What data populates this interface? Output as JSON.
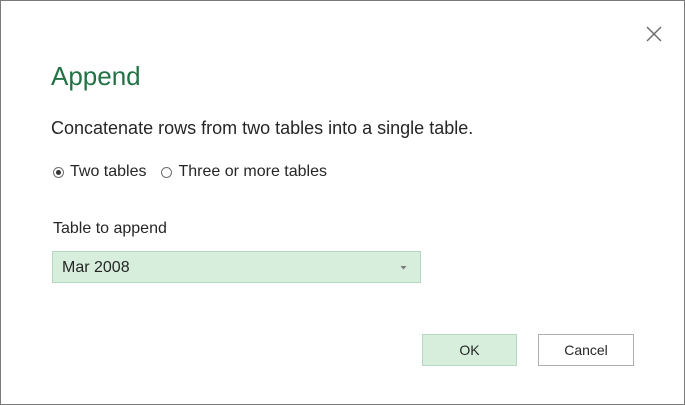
{
  "dialog": {
    "title": "Append",
    "description": "Concatenate rows from two tables into a single table.",
    "close_icon": "close-icon"
  },
  "mode": {
    "options": [
      {
        "label": "Two tables",
        "selected": true
      },
      {
        "label": "Three or more tables",
        "selected": false
      }
    ]
  },
  "append_field": {
    "label": "Table to append",
    "value": "Mar 2008",
    "dropdown_icon": "dropdown-arrow-icon"
  },
  "buttons": {
    "ok_label": "OK",
    "cancel_label": "Cancel"
  },
  "colors": {
    "accent_green": "#217346",
    "selection_fill": "#d7eedd",
    "selection_border": "#b4d8c2",
    "text": "#262626"
  }
}
